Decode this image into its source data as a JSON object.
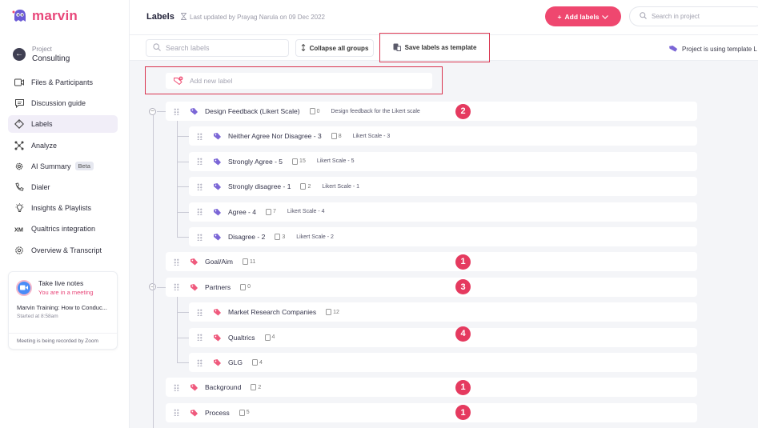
{
  "app": {
    "name": "marvin",
    "brand_color": "#ef476f"
  },
  "project": {
    "label": "Project",
    "name": "Consulting"
  },
  "nav": [
    {
      "label": "Files & Participants",
      "icon": "video-file-icon"
    },
    {
      "label": "Discussion guide",
      "icon": "message-icon"
    },
    {
      "label": "Labels",
      "icon": "tag-icon",
      "active": true
    },
    {
      "label": "Analyze",
      "icon": "analyze-icon"
    },
    {
      "label": "AI Summary",
      "icon": "gear-icon",
      "badge": "Beta"
    },
    {
      "label": "Dialer",
      "icon": "phone-icon"
    },
    {
      "label": "Insights & Playlists",
      "icon": "lightbulb-icon"
    },
    {
      "label": "Qualtrics integration",
      "icon": "xm-icon"
    },
    {
      "label": "Overview & Transcript",
      "icon": "settings-icon"
    }
  ],
  "meeting": {
    "title": "Take live notes",
    "status": "You are in a meeting",
    "name": "Marvin Training: How to Conduc...",
    "started": "Started at 8:58am",
    "footer": "Meeting is being recorded by Zoom"
  },
  "header": {
    "title": "Labels",
    "updated": "Last updated by Prayag Narula on 09 Dec 2022",
    "add_button": "Add labels",
    "search_placeholder": "Search in project"
  },
  "toolbar": {
    "search_placeholder": "Search labels",
    "collapse": "Collapse all groups",
    "save_template": "Save labels as template",
    "template_note": "Project is using template L"
  },
  "add_label_placeholder": "Add new label",
  "colors": {
    "purple_tag": "#7b66d6",
    "pink_tag": "#ef5a7d",
    "highlight": "#d9344f"
  },
  "labels": [
    {
      "name": "Design Feedback (Likert Scale)",
      "count": "0",
      "desc": "Design feedback for the Likert scale",
      "color": "purple",
      "level": 0,
      "group": true,
      "badge": "2"
    },
    {
      "name": "Neither Agree Nor Disagree - 3",
      "count": "8",
      "desc": "Likert Scale - 3",
      "color": "purple",
      "level": 1
    },
    {
      "name": "Strongly Agree - 5",
      "count": "15",
      "desc": "Likert Scale - 5",
      "color": "purple",
      "level": 1
    },
    {
      "name": "Strongly disagree - 1",
      "count": "2",
      "desc": "Likert Scale - 1",
      "color": "purple",
      "level": 1
    },
    {
      "name": "Agree - 4",
      "count": "7",
      "desc": "Likert Scale - 4",
      "color": "purple",
      "level": 1
    },
    {
      "name": "Disagree - 2",
      "count": "3",
      "desc": "Likert Scale - 2",
      "color": "purple",
      "level": 1
    },
    {
      "name": "Goal/Aim",
      "count": "11",
      "desc": "",
      "color": "pink",
      "level": 0,
      "badge": "1"
    },
    {
      "name": "Partners",
      "count": "0",
      "desc": "",
      "color": "pink",
      "level": 0,
      "group": true,
      "badge": "3"
    },
    {
      "name": "Market Research Companies",
      "count": "12",
      "desc": "",
      "color": "pink",
      "level": 1
    },
    {
      "name": "Qualtrics",
      "count": "4",
      "desc": "",
      "color": "pink",
      "level": 1,
      "badge": "4"
    },
    {
      "name": "GLG",
      "count": "4",
      "desc": "",
      "color": "pink",
      "level": 1
    },
    {
      "name": "Background",
      "count": "2",
      "desc": "",
      "color": "pink",
      "level": 0,
      "badge": "1"
    },
    {
      "name": "Process",
      "count": "5",
      "desc": "",
      "color": "pink",
      "level": 0,
      "badge": "1"
    }
  ]
}
